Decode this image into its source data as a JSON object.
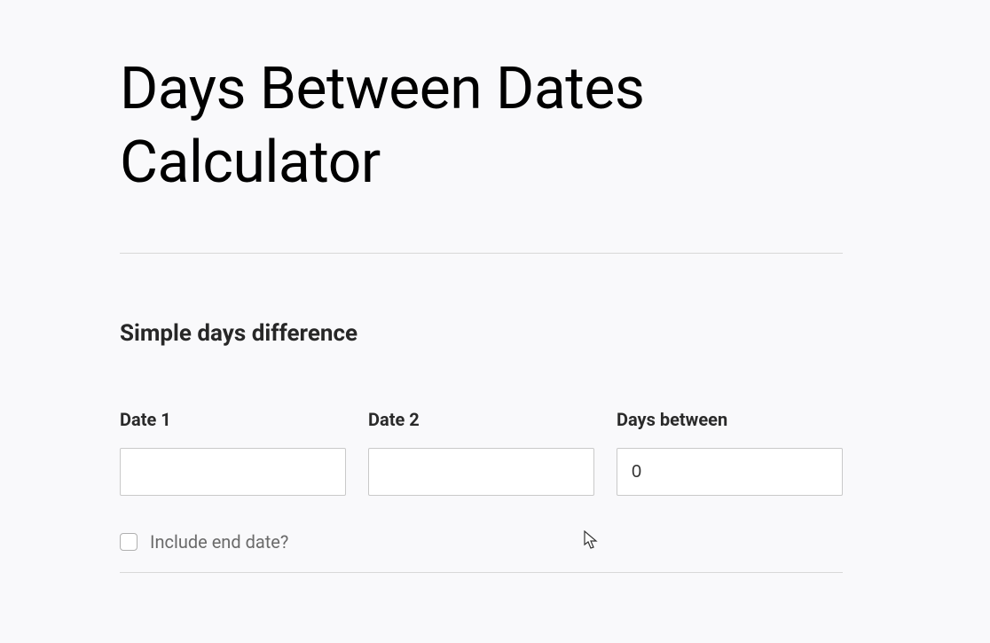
{
  "page": {
    "title": "Days Between Dates Calculator"
  },
  "section": {
    "heading": "Simple days difference",
    "fields": {
      "date1": {
        "label": "Date 1",
        "value": ""
      },
      "date2": {
        "label": "Date 2",
        "value": ""
      },
      "days_between": {
        "label": "Days between",
        "value": "0"
      }
    },
    "include_end_date": {
      "label": "Include end date?",
      "checked": false
    }
  }
}
